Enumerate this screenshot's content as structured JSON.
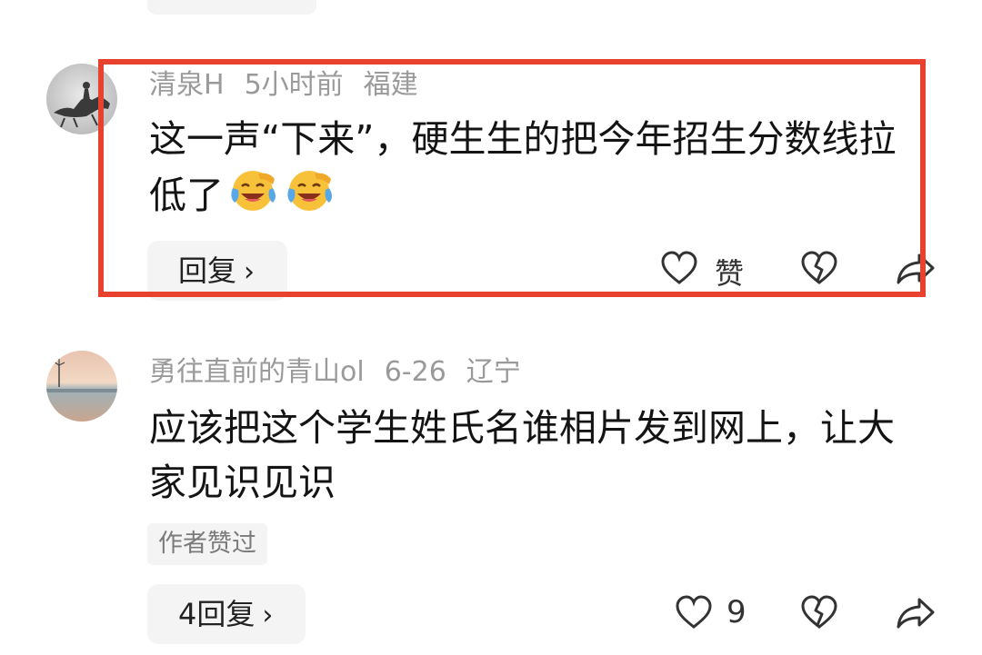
{
  "comments": [
    {
      "username": "清泉H",
      "time": "5小时前",
      "location": "福建",
      "text": "这一声“下来”，硬生生的把今年招生分数线拉低了",
      "emojis": [
        "laugh-cry-emoji",
        "laugh-cry-emoji"
      ],
      "reply_label": "回复",
      "like_label": "赞",
      "highlighted": true,
      "highlight_color": "#e8412e"
    },
    {
      "username": "勇往直前的青山ol",
      "time": "6-26",
      "location": "辽宁",
      "text": "应该把这个学生姓氏名谁相片发到网上，让大家见识见识",
      "tag": "作者赞过",
      "reply_label": "4回复",
      "like_count": "9"
    }
  ],
  "icons": {
    "like": "heart-icon",
    "dislike": "broken-heart-icon",
    "share": "share-arrow-icon",
    "chevron": "›"
  }
}
